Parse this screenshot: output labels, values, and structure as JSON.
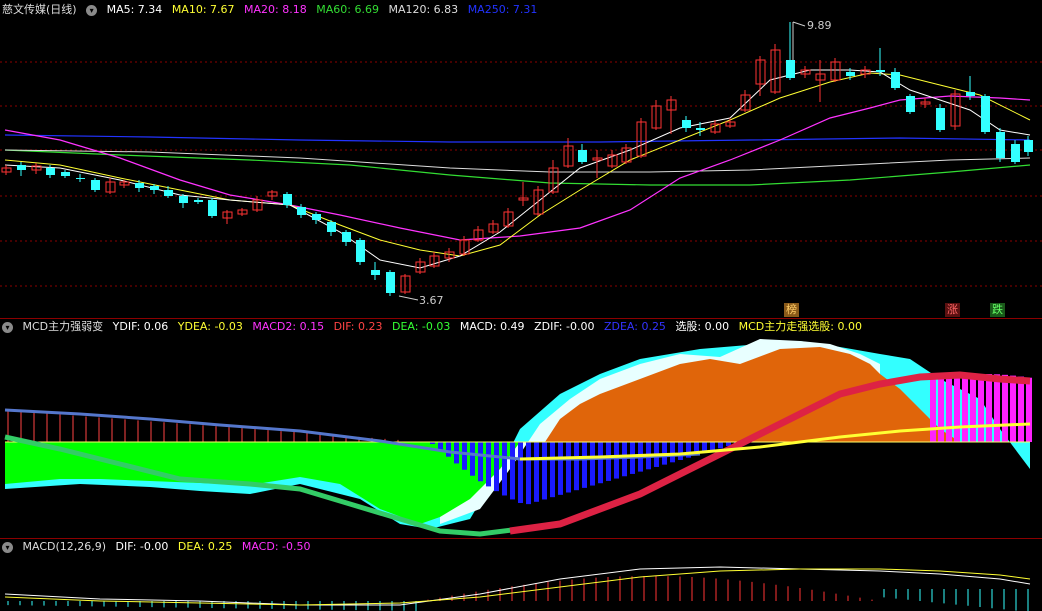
{
  "main_panel": {
    "title": "慈文传媒(日线)",
    "indicators": [
      {
        "label": "MA5: 7.34",
        "color": "#ffffff"
      },
      {
        "label": "MA10: 7.67",
        "color": "#ffff33"
      },
      {
        "label": "MA20: 8.18",
        "color": "#ff33ff"
      },
      {
        "label": "MA60: 6.69",
        "color": "#33dd33"
      },
      {
        "label": "MA120: 6.83",
        "color": "#dddddd"
      },
      {
        "label": "MA250: 7.31",
        "color": "#2233ff"
      }
    ],
    "high_label": "9.89",
    "low_label": "3.67",
    "markers": [
      {
        "text": "榜",
        "bg": "#8a5a1a",
        "color": "#ffcc66"
      },
      {
        "text": "涨",
        "bg": "#5a1010",
        "color": "#ff6666"
      },
      {
        "text": "跌",
        "bg": "#1a5a1a",
        "color": "#66ff66"
      }
    ]
  },
  "mcd_panel": {
    "title": "MCD主力强弱变",
    "values": [
      {
        "label": "YDIF: 0.06",
        "color": "#ffffff"
      },
      {
        "label": "YDEA: -0.03",
        "color": "#ffff33"
      },
      {
        "label": "MACD2: 0.15",
        "color": "#ff33ff"
      },
      {
        "label": "DIF: 0.23",
        "color": "#ff4444"
      },
      {
        "label": "DEA: -0.03",
        "color": "#33ff33"
      },
      {
        "label": "MACD: 0.49",
        "color": "#ffffff"
      },
      {
        "label": "ZDIF: -0.00",
        "color": "#ffffff"
      },
      {
        "label": "ZDEA: 0.25",
        "color": "#3333ff"
      },
      {
        "label": "选股: 0.00",
        "color": "#ffffff"
      },
      {
        "label": "MCD主力走强选股: 0.00",
        "color": "#ffff33"
      }
    ]
  },
  "macd_panel": {
    "title": "MACD(12,26,9)",
    "values": [
      {
        "label": "DIF: -0.00",
        "color": "#ffffff"
      },
      {
        "label": "DEA: 0.25",
        "color": "#ffff33"
      },
      {
        "label": "MACD: -0.50",
        "color": "#ff33ff"
      }
    ]
  },
  "colors": {
    "up": "#ff3333",
    "down": "#33ffff",
    "grid": "#8b0000"
  },
  "chart_data": {
    "type": "candlestick",
    "high": 9.89,
    "low": 3.67,
    "ma_current": {
      "MA5": 7.34,
      "MA10": 7.67,
      "MA20": 8.18,
      "MA60": 6.69,
      "MA120": 6.83,
      "MA250": 7.31
    },
    "mcd_current": {
      "YDIF": 0.06,
      "YDEA": -0.03,
      "MACD2": 0.15,
      "DIF": 0.23,
      "DEA": -0.03,
      "MACD": 0.49,
      "ZDIF": -0.0,
      "ZDEA": 0.25
    },
    "macd_current": {
      "DIF": -0.0,
      "DEA": 0.25,
      "MACD": -0.5
    }
  }
}
